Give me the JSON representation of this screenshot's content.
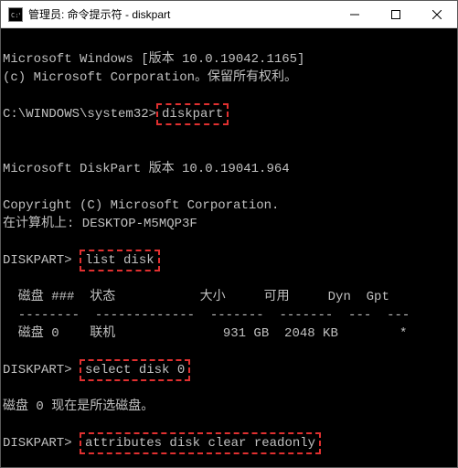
{
  "titlebar": {
    "title": "管理员: 命令提示符 - diskpart"
  },
  "console": {
    "line1": "Microsoft Windows [版本 10.0.19042.1165]",
    "line2": "(c) Microsoft Corporation。保留所有权利。",
    "prompt1_prefix": "C:\\WINDOWS\\system32>",
    "cmd1": "diskpart",
    "line3": "Microsoft DiskPart 版本 10.0.19041.964",
    "line4": "Copyright (C) Microsoft Corporation.",
    "line5": "在计算机上: DESKTOP-M5MQP3F",
    "prompt2_prefix": "DISKPART> ",
    "cmd2": "list disk",
    "table_header": "  磁盘 ###  状态           大小     可用     Dyn  Gpt",
    "table_divider": "  --------  -------------  -------  -------  ---  ---",
    "table_row1": "  磁盘 0    联机              931 GB  2048 KB        *",
    "prompt3_prefix": "DISKPART> ",
    "cmd3": "select disk 0",
    "line6": "磁盘 0 现在是所选磁盘。",
    "prompt4_prefix": "DISKPART> ",
    "cmd4": "attributes disk clear readonly"
  }
}
